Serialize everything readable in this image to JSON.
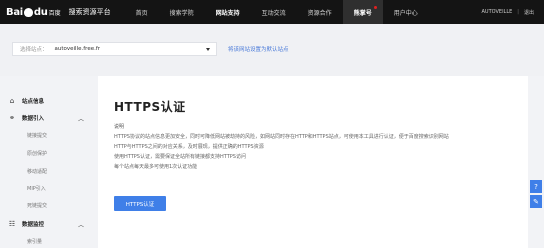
{
  "header": {
    "logo_left": "Bai",
    "logo_right": "du",
    "logo_sub": "百度",
    "site_title": "搜索资源平台",
    "nav": [
      {
        "label": "首页"
      },
      {
        "label": "搜索学院"
      },
      {
        "label": "网站支持"
      },
      {
        "label": "互动交流"
      },
      {
        "label": "资源合作"
      },
      {
        "label": "熊掌号"
      },
      {
        "label": "用户中心"
      }
    ],
    "user": "AUTOVEILLE",
    "logout": "退出"
  },
  "site_selector": {
    "label": "选择站点：",
    "value": "autoveille.free.fr",
    "default_link": "将该网站设置为默认站点"
  },
  "sidebar": {
    "groups": [
      {
        "label": "站点信息"
      },
      {
        "label": "数据引入",
        "chevron": "︿"
      },
      {
        "label": "数据监控",
        "chevron": "︿"
      }
    ],
    "sub_items": [
      "链接提交",
      "原创保护",
      "移动适配",
      "MIP引入",
      "死链提交",
      "索引量"
    ]
  },
  "main": {
    "title": "HTTPS认证",
    "desc_heading": "说明",
    "desc_lines": [
      "HTTPS协议的站点信息更加安全，同时可降低网站被劫持的风险，如网站同时存在HTTP和HTTPS站点，可使用本工具进行认证，便于百度搜索识别网站",
      "HTTP与HTTPS之间的对应关系，及时展现，提供正确的HTTPS资源",
      "使用HTTPS认证，需要保证全站所有链接都支持HTTPS访问",
      "每个站点每天最多可使用1次认证功能"
    ],
    "button_label": "HTTPS认证"
  },
  "float_tools": {
    "help": "?",
    "feedback": "✎"
  }
}
